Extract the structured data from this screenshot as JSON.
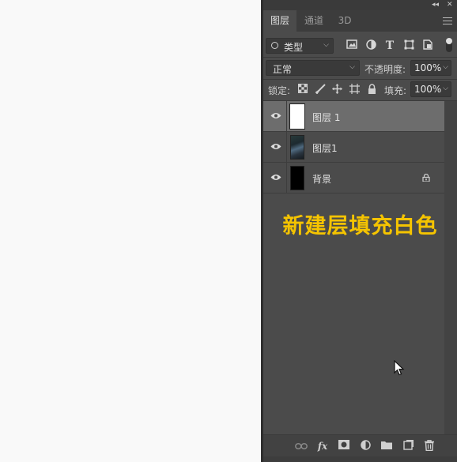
{
  "panel": {
    "tabs": [
      {
        "label": "图层",
        "active": true
      },
      {
        "label": "通道",
        "active": false
      },
      {
        "label": "3D",
        "active": false
      }
    ],
    "window_controls": {
      "collapse": "◂◂",
      "close": "✕"
    },
    "filter": {
      "label": "类型"
    },
    "filter_icons": [
      "image-filter-icon",
      "adjustment-filter-icon",
      "type-filter-icon",
      "shape-filter-icon",
      "smart-object-filter-icon"
    ],
    "type_filter_glyph": "T",
    "blend_mode": "正常",
    "opacity_label": "不透明度:",
    "opacity_value": "100%",
    "lock_label": "锁定:",
    "fill_label": "填充:",
    "fill_value": "100%",
    "layers": [
      {
        "name": "图层 1",
        "thumbnail": "white",
        "selected": true,
        "visible": true,
        "locked": false
      },
      {
        "name": "图层1",
        "thumbnail": "photo",
        "selected": false,
        "visible": true,
        "locked": false
      },
      {
        "name": "背景",
        "thumbnail": "black",
        "selected": false,
        "visible": true,
        "locked": true
      }
    ],
    "caption": "新建层填充白色",
    "caption_color": "#f5c400",
    "fx_glyph": "fx",
    "bottom_icons": [
      "link-layers-icon",
      "fx-icon",
      "add-mask-icon",
      "adjustment-layer-icon",
      "new-group-icon",
      "new-layer-icon",
      "delete-layer-icon"
    ]
  },
  "colors": {
    "panel_bg": "#4b4b4b",
    "selected_layer_bg": "#6d6d6d",
    "canvas_bg": "#f9f9f9"
  }
}
